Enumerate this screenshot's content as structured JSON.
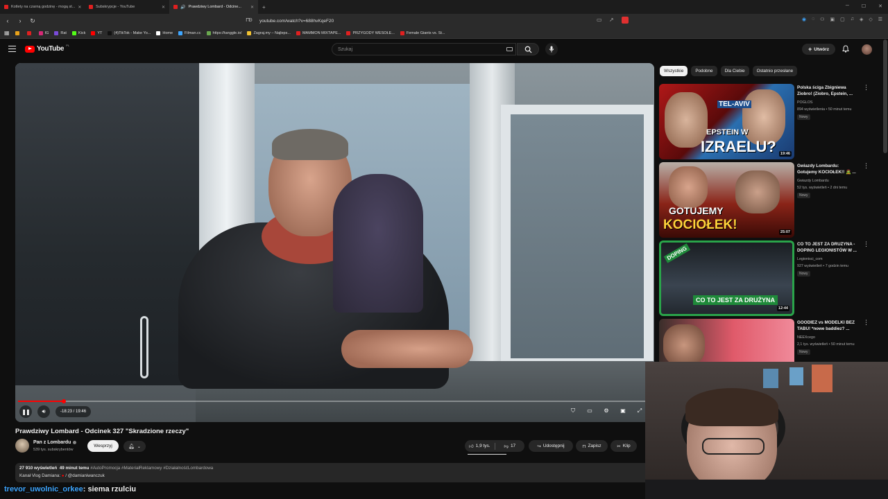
{
  "browser": {
    "tabs": [
      {
        "label": "Kotlety na czarną godzinę - mogą st..."
      },
      {
        "label": "Subskrypcje - YouTube"
      },
      {
        "label": "Prawdziwy Lombard - Odcine..."
      }
    ],
    "url": "youtube.com/watch?v=688hvKqeF20",
    "bookmarks": [
      {
        "label": "",
        "color": "#e8a21a"
      },
      {
        "label": "",
        "color": "#e02020"
      },
      {
        "label": "IG",
        "color": "#d62976"
      },
      {
        "label": "Rat",
        "color": "#7a4bd9"
      },
      {
        "label": "Kick",
        "color": "#53fc18"
      },
      {
        "label": "YT",
        "color": "#ff0000"
      },
      {
        "label": "(4)TikTok - Make Yo...",
        "color": "#111111"
      },
      {
        "label": "Home",
        "color": "#ffffff"
      },
      {
        "label": "Filman.cc",
        "color": "#3ea6ff"
      },
      {
        "label": "https://tanggle.io/",
        "color": "#6aa84f"
      },
      {
        "label": "Zagraj.my – Najleps...",
        "color": "#f1c232"
      },
      {
        "label": "MAMMON MIXTAPE...",
        "color": "#e02020"
      },
      {
        "label": "PRZYGODY WESOŁE...",
        "color": "#e02020"
      },
      {
        "label": "Female Giants vs. St...",
        "color": "#e02020"
      }
    ]
  },
  "header": {
    "logo_text": "YouTube",
    "logo_region": "PL",
    "search_placeholder": "Szukaj",
    "create_label": "Utwórz"
  },
  "player": {
    "time": "-18:23 / 19:46",
    "progress_fraction": 0.072
  },
  "video": {
    "title": "Prawdziwy Lombard - Odcinek 327 \"Skradzione rzeczy\"",
    "channel": "Pan z Lombardu",
    "subscribers": "539 tys. subskrybentów",
    "support_label": "Wesprzyj",
    "likes": "1,9 tys.",
    "dislikes": "17",
    "share_label": "Udostępnij",
    "save_label": "Zapisz",
    "clip_label": "Klip",
    "views": "27 910 wyświetleń",
    "age": "49 minut temu",
    "tags": "#AutoPromocja #MateriałReklamowy #DziałalnośćLombardowa",
    "desc_line2": "Kanał Vlog Damiana:",
    "desc_handle": "/ @damianiwanczuk"
  },
  "sidebar": {
    "chips": [
      "Wszystkie",
      "Podobne",
      "Dla Ciebie",
      "Ostatnio przesłane"
    ],
    "items": [
      {
        "title": "Polska ściga Zbigniewa Ziobro! (Ziobro, Epstein, ...",
        "channel": "POGLOS",
        "meta": "894 wyświetlenia • 50 minut temu",
        "badge": "Nowy",
        "duration": "19:46",
        "thumb_text1": "TEL-AVIV",
        "thumb_text2": "EPSTEIN W",
        "thumb_text3": "IZRAELU?"
      },
      {
        "title": "Gwiazdy Lombardu: Gotujemy KOCIOŁEK!! 🧟 ...",
        "channel": "Gwiazdy Lombardu",
        "meta": "52 tys. wyświetleń • 2 dni temu",
        "badge": "Nowy",
        "duration": "25:07",
        "thumb_text1": "GOTUJEMY",
        "thumb_text2": "KOCIOŁEK!"
      },
      {
        "title": "CO TO JEST ZA DRUŻYNA - DOPING LEGIONISTÓW W ...",
        "channel": "Legionisci_com",
        "meta": "927 wyświetleń • 7 godzin temu",
        "badge": "Nowy",
        "duration": "12:44",
        "thumb_text1": "DOPING",
        "thumb_text2": "CO TO JEST ZA DRUŻYNA"
      },
      {
        "title": "GOODIEZ vs MODELKI BEZ TABU! *nowe baddiez? ...",
        "channel": "NEEXcego",
        "meta": "2,1 tys. wyświetleń • 50 minut temu",
        "badge": "Nowy",
        "duration": ""
      }
    ]
  },
  "chat": {
    "user": "trevor_uwolnic_orkee",
    "message": ": siema rzulciu"
  },
  "colors": {
    "accent": "#ff0000",
    "background": "#0f0f0f",
    "link": "#3ea6ff"
  }
}
